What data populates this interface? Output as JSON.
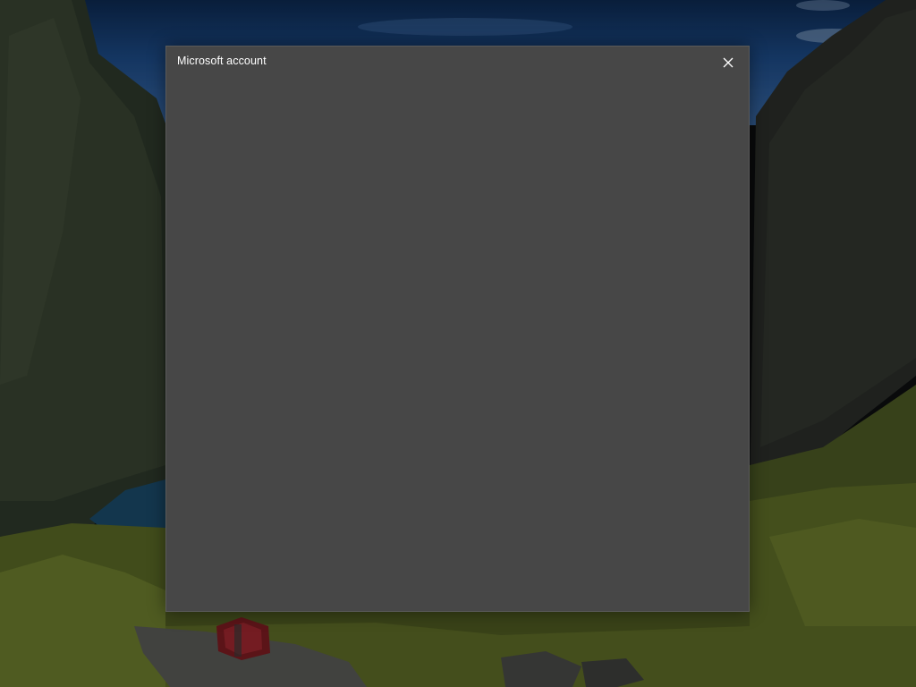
{
  "dialog": {
    "title": "Microsoft account",
    "close_icon": "close-icon",
    "background_color": "#474747"
  },
  "wallpaper": {
    "description_icon": "lock-screen-wallpaper"
  }
}
